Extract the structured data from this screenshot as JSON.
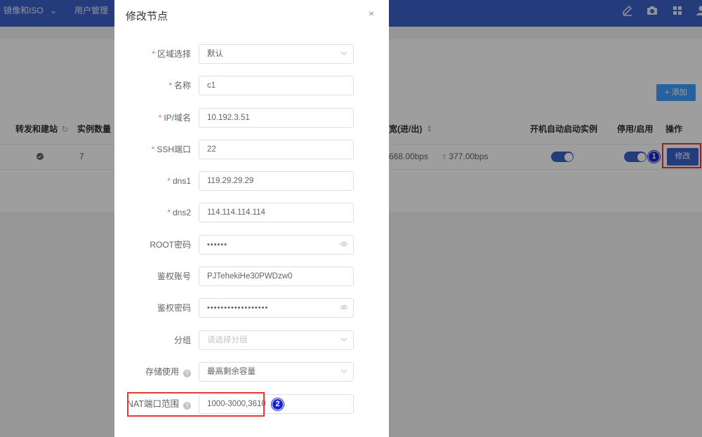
{
  "nav": {
    "items": [
      {
        "label": "镜像和ISO",
        "caret": "⌄"
      },
      {
        "label": "用户管理"
      }
    ],
    "tools": [
      "edit-icon",
      "camera-icon",
      "grid-icon",
      "user-icon"
    ]
  },
  "page": {
    "add_button": "+ 添加",
    "table": {
      "headers": {
        "relay": "转发和建站",
        "instances": "实例数量",
        "bandwidth": "宽(进/出)",
        "autostart": "开机自动启动实例",
        "enable": "停用/启用",
        "actions": "操作"
      },
      "row": {
        "instances": "7",
        "bw_in": "668.00bps",
        "bw_out_arrow": "↑",
        "bw_out": "377.00bps",
        "edit": "修改"
      }
    },
    "markers": {
      "one": "1",
      "two": "2"
    }
  },
  "dialog": {
    "title": "修改节点",
    "close": "×",
    "fields": [
      {
        "label": "区域选择",
        "required": true,
        "value": "默认",
        "type": "select"
      },
      {
        "label": "名称",
        "required": true,
        "value": "c1",
        "type": "text"
      },
      {
        "label": "IP/域名",
        "required": true,
        "value": "10.192.3.51",
        "type": "text"
      },
      {
        "label": "SSH端口",
        "required": true,
        "value": "22",
        "type": "text"
      },
      {
        "label": "dns1",
        "required": true,
        "value": "119.29.29.29",
        "type": "text"
      },
      {
        "label": "dns2",
        "required": true,
        "value": "114.114.114.114",
        "type": "text"
      },
      {
        "label": "ROOT密码",
        "required": false,
        "value": "••••••",
        "type": "password"
      },
      {
        "label": "鉴权账号",
        "required": false,
        "value": "PJTehekiHe30PWDzw0",
        "type": "text"
      },
      {
        "label": "鉴权密码",
        "required": false,
        "value": "••••••••••••••••••",
        "type": "password"
      },
      {
        "label": "分组",
        "required": false,
        "value": "",
        "placeholder": "请选择分组",
        "type": "select"
      },
      {
        "label": "存储使用",
        "required": false,
        "help": true,
        "value": "最高剩余容量",
        "type": "select"
      },
      {
        "label": "NAT端口范围",
        "required": false,
        "help": true,
        "value": "1000-3000,3610",
        "type": "text"
      }
    ]
  },
  "colors": {
    "primary": "#3a5fc9",
    "accent": "#409eff",
    "highlight": "#e53935",
    "marker": "#1a23c9"
  }
}
